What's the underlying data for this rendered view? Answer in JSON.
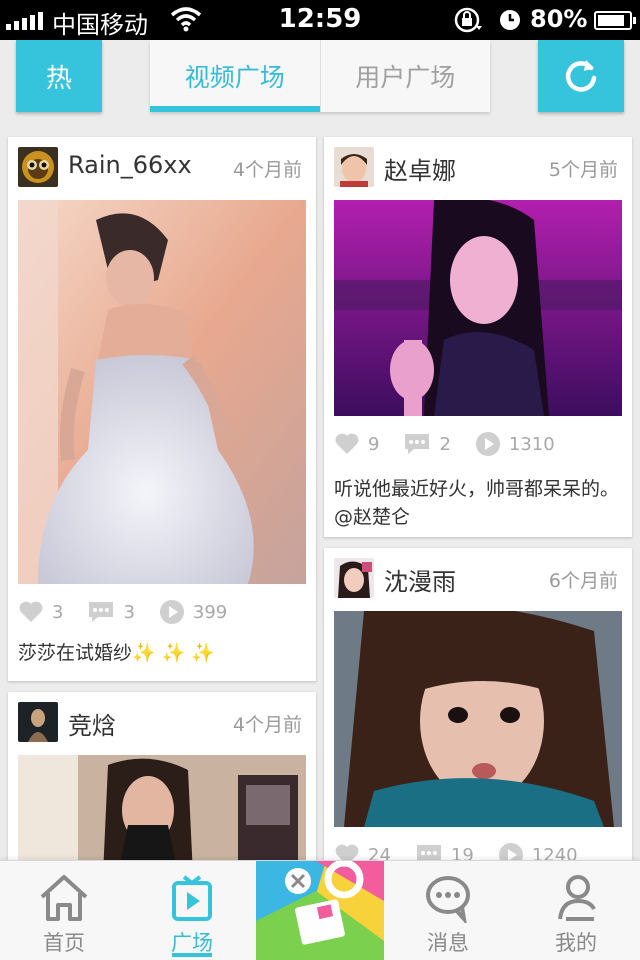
{
  "status_bar": {
    "carrier": "中国移动",
    "time": "12:59",
    "battery": "80%",
    "battery_level": 0.8
  },
  "header": {
    "hot_label": "热",
    "tabs": [
      {
        "label": "视频广场",
        "active": true
      },
      {
        "label": "用户广场",
        "active": false
      }
    ],
    "refresh_icon": "refresh-icon"
  },
  "feed": {
    "left": [
      {
        "user": "Rain_66xx",
        "time": "4个月前",
        "likes": "3",
        "comments": "3",
        "plays": "399",
        "caption": "莎莎在试婚纱✨ ✨ ✨"
      },
      {
        "user": "竞焓",
        "time": "4个月前"
      }
    ],
    "right": [
      {
        "user": "赵卓娜",
        "time": "5个月前",
        "likes": "9",
        "comments": "2",
        "plays": "1310",
        "caption": "听说他最近好火，帅哥都呆呆的。@赵楚仑"
      },
      {
        "user": "沈漫雨",
        "time": "6个月前",
        "likes": "24",
        "comments": "19",
        "plays": "1240"
      }
    ]
  },
  "tabbar": {
    "items": [
      {
        "label": "首页",
        "icon": "home-icon"
      },
      {
        "label": "广场",
        "icon": "play-square-icon",
        "active": true
      },
      {
        "label": "",
        "icon": "camera-app-icon"
      },
      {
        "label": "消息",
        "icon": "chat-bubble-icon"
      },
      {
        "label": "我的",
        "icon": "person-icon"
      }
    ]
  },
  "colors": {
    "accent": "#35c4dc",
    "status_bg": "#000000",
    "background": "#ececec"
  }
}
